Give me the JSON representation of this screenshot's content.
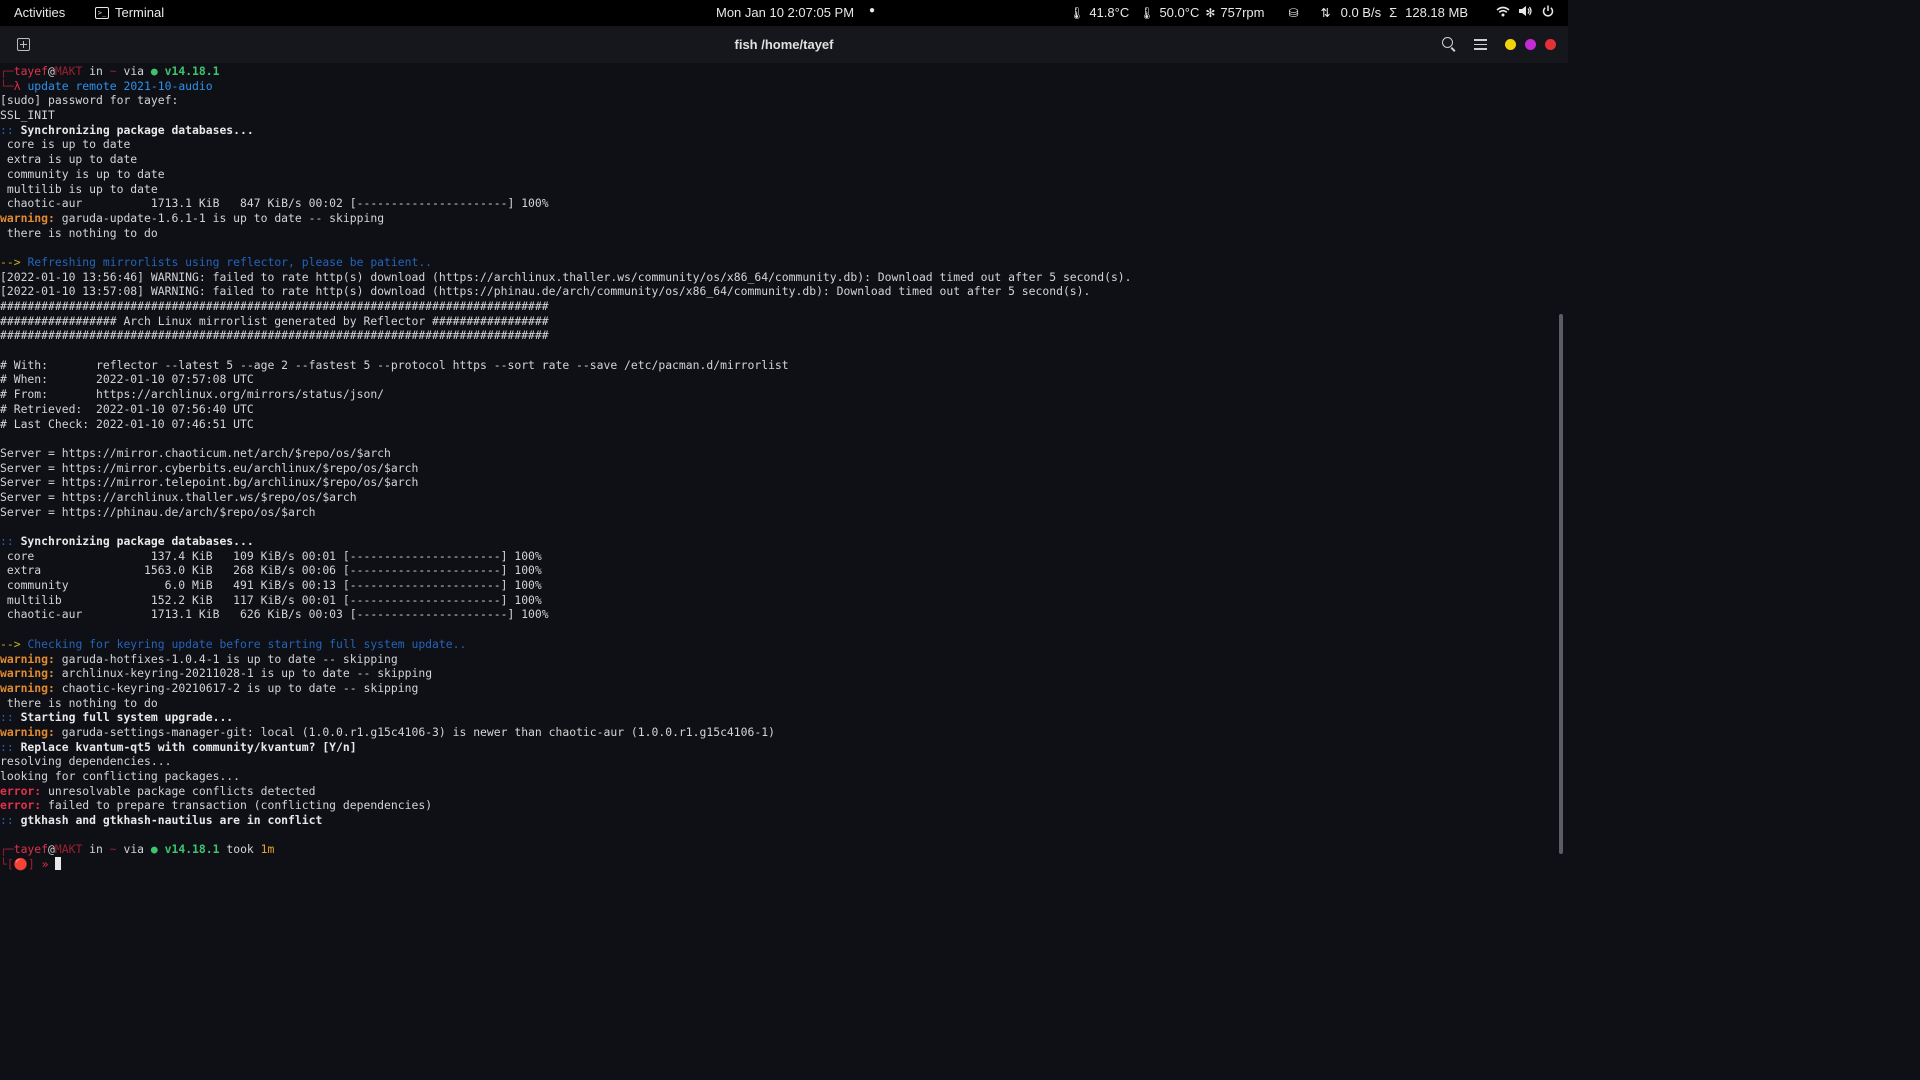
{
  "topbar": {
    "activities": "Activities",
    "app_name": "Terminal",
    "clock": "Mon Jan 10  2:07:05 PM",
    "dot": "●",
    "cpu_temp": "41.8°C",
    "gpu_temp": "50.0°C",
    "fan": "757rpm",
    "net_speed": "0.0 B/s",
    "mem": "128.18 MB",
    "icons": {
      "thermometer": "🌡",
      "fan": "✻",
      "gpu": "⛁",
      "net": "⇅",
      "sigma": "Σ",
      "wifi": "wifi-icon",
      "volume": "🔊",
      "power": "⏻"
    }
  },
  "header": {
    "title": "fish /home/tayef",
    "window_colors": [
      "#f2d40a",
      "#c42bd2",
      "#e53136"
    ]
  },
  "prompt": {
    "user": "tayef",
    "host": "MAKT",
    "in": "in",
    "dir": "~",
    "via": "via",
    "node_dot": "●",
    "node": "v14.18.1",
    "took": "took",
    "duration": "1m",
    "lambda": "λ",
    "command_word": "update",
    "command_args": "remote 2021-10-audio",
    "status_rec": "🔴",
    "arrow": "»"
  },
  "lines": {
    "l003": "[sudo] password for tayef:",
    "l004": "SSL_INIT",
    "l005": "Synchronizing package databases...",
    "l006": " core is up to date",
    "l007": " extra is up to date",
    "l008": " community is up to date",
    "l009": " multilib is up to date",
    "l010": " chaotic-aur          1713.1 KiB   847 KiB/s 00:02 [----------------------] 100%",
    "l011": "garuda-update-1.6.1-1 is up to date -- skipping",
    "l012": " there is nothing to do",
    "l014": "Refreshing mirrorlists using reflector, please be patient..",
    "l015": "[2022-01-10 13:56:46] WARNING: failed to rate http(s) download (https://archlinux.thaller.ws/community/os/x86_64/community.db): Download timed out after 5 second(s).",
    "l016": "[2022-01-10 13:57:08] WARNING: failed to rate http(s) download (https://phinau.de/arch/community/os/x86_64/community.db): Download timed out after 5 second(s).",
    "l017": "################################################################################",
    "l018": "################# Arch Linux mirrorlist generated by Reflector #################",
    "l019": "################################################################################",
    "l021": "# With:       reflector --latest 5 --age 2 --fastest 5 --protocol https --sort rate --save /etc/pacman.d/mirrorlist",
    "l022": "# When:       2022-01-10 07:57:08 UTC",
    "l023": "# From:       https://archlinux.org/mirrors/status/json/",
    "l024": "# Retrieved:  2022-01-10 07:56:40 UTC",
    "l025": "# Last Check: 2022-01-10 07:46:51 UTC",
    "l027": "Server = https://mirror.chaoticum.net/arch/$repo/os/$arch",
    "l028": "Server = https://mirror.cyberbits.eu/archlinux/$repo/os/$arch",
    "l029": "Server = https://mirror.telepoint.bg/archlinux/$repo/os/$arch",
    "l030": "Server = https://archlinux.thaller.ws/$repo/os/$arch",
    "l031": "Server = https://phinau.de/arch/$repo/os/$arch",
    "l033": "Synchronizing package databases...",
    "l034": " core                 137.4 KiB   109 KiB/s 00:01 [----------------------] 100%",
    "l035": " extra               1563.0 KiB   268 KiB/s 00:06 [----------------------] 100%",
    "l036": " community              6.0 MiB   491 KiB/s 00:13 [----------------------] 100%",
    "l037": " multilib             152.2 KiB   117 KiB/s 00:01 [----------------------] 100%",
    "l038": " chaotic-aur          1713.1 KiB   626 KiB/s 00:03 [----------------------] 100%",
    "l040": "Checking for keyring update before starting full system update..",
    "l041": "garuda-hotfixes-1.0.4-1 is up to date -- skipping",
    "l042": "archlinux-keyring-20211028-1 is up to date -- skipping",
    "l043": "chaotic-keyring-20210617-2 is up to date -- skipping",
    "l044": " there is nothing to do",
    "l045": "Starting full system upgrade...",
    "l046": "garuda-settings-manager-git: local (1.0.0.r1.g15c4106-3) is newer than chaotic-aur (1.0.0.r1.g15c4106-1)",
    "l047": "Replace kvantum-qt5 with community/kvantum? [Y/n]",
    "l048": "resolving dependencies...",
    "l049": "looking for conflicting packages...",
    "l050": "unresolvable package conflicts detected",
    "l051": "failed to prepare transaction (conflicting dependencies)",
    "l052": "gtkhash and gtkhash-nautilus are in conflict"
  },
  "labels": {
    "warning": "warning:",
    "error": "error:",
    "colons": "::",
    "arrow": "-->"
  }
}
